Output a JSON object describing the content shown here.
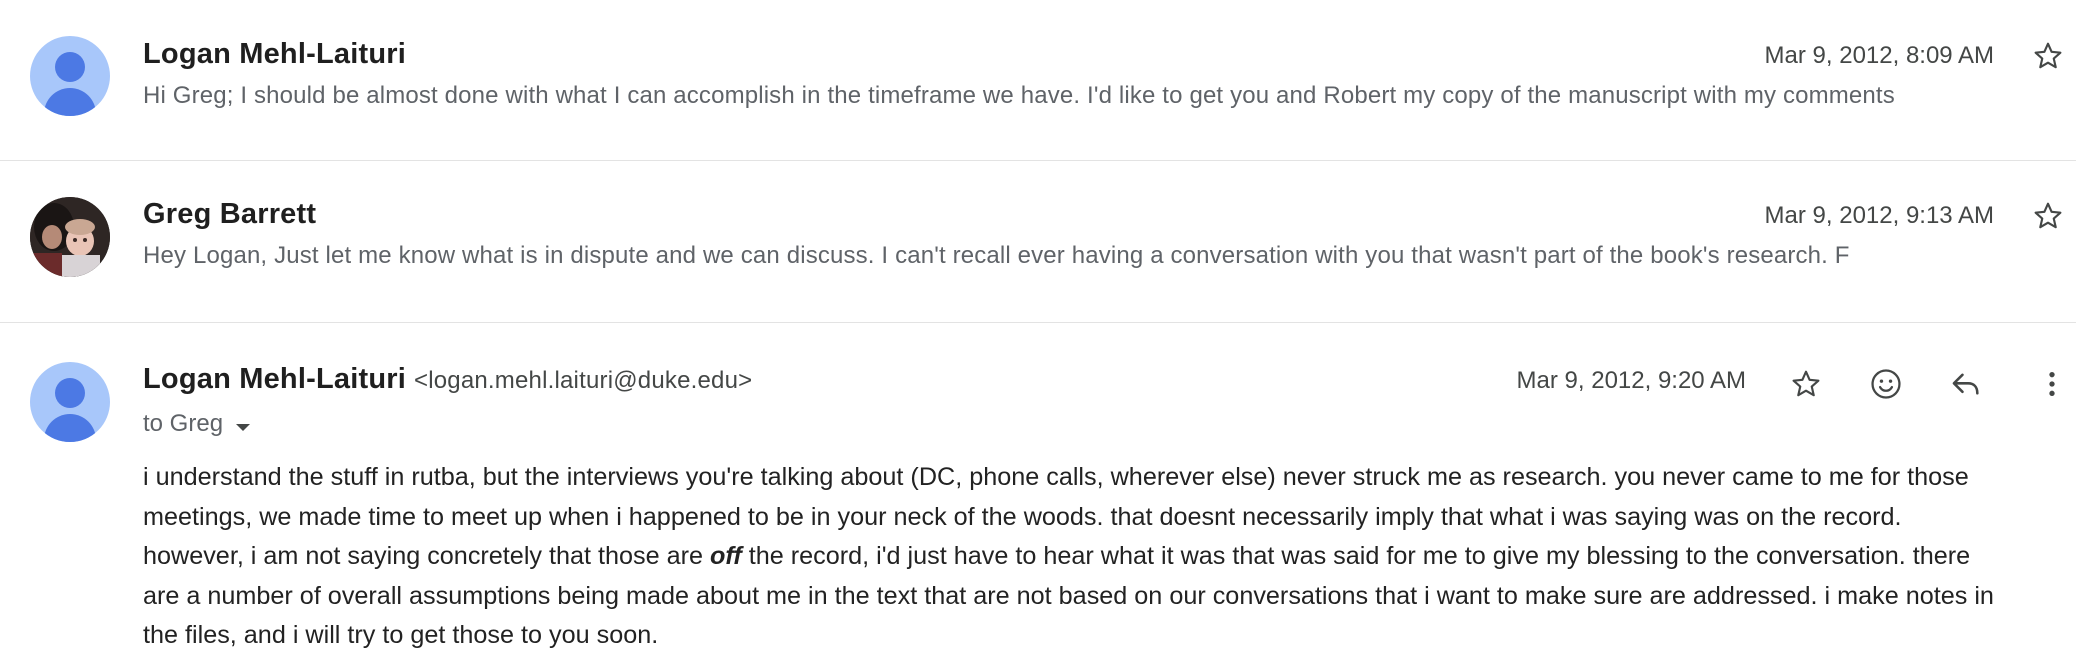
{
  "thread": {
    "messages": [
      {
        "sender": "Logan Mehl-Laituri",
        "date": "Mar 9, 2012, 8:09 AM",
        "snippet": "Hi Greg; I should be almost done with what I can accomplish in the timeframe we have. I'd like to get you and Robert my copy of the manuscript with my comments",
        "avatar": "default-person-icon"
      },
      {
        "sender": "Greg Barrett",
        "date": "Mar 9, 2012, 9:13 AM",
        "snippet": "Hey Logan, Just let me know what is in dispute and we can discuss. I can't recall ever having a conversation with you that wasn't part of the book's research. F",
        "avatar": "photo"
      },
      {
        "sender": "Logan Mehl-Laituri",
        "email": "<logan.mehl.laituri@duke.edu>",
        "date": "Mar 9, 2012, 9:20 AM",
        "recipients": "to Greg",
        "avatar": "default-person-icon",
        "body": {
          "line1": "i understand the stuff in rutba, but the interviews you're talking about (DC, phone calls, wherever else) never struck me as research. you never came to me for those",
          "line2": "meetings, we made time to meet up when i happened to be in your neck of the woods. that doesnt necessarily imply that what i was saying was on the record.",
          "line3_before": "however, i am not saying concretely that those are ",
          "line3_emphasis": "off",
          "line3_after": " the record, i'd just have to hear what it was that was said for me to give my blessing to the conversation. there",
          "line4": "are a number of overall assumptions being made about me in the text that are not based on our conversations that i want to make sure are addressed. i make notes in",
          "line5": "the files, and i will try to get those to you soon."
        }
      }
    ]
  },
  "icons": {
    "star": "star-outline-icon",
    "emoji": "emoji-reaction-icon",
    "reply": "reply-icon",
    "more": "more-vert-icon",
    "caret": "dropdown-caret-icon"
  },
  "colors": {
    "avatar_bg": "#a8c7fa",
    "avatar_fg": "#4c79e4",
    "divider": "#e3e3e3",
    "icon": "#444746"
  }
}
